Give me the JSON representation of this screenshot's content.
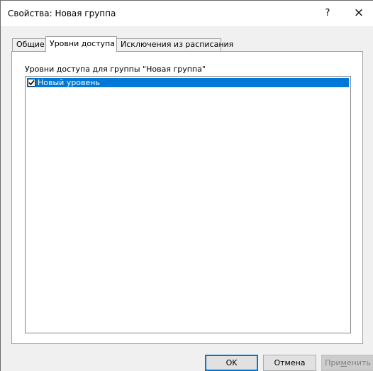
{
  "window": {
    "title": "Свойства: Новая группа",
    "help_glyph": "?",
    "close_glyph": "×"
  },
  "tabs": [
    {
      "label": "Общие",
      "active": false
    },
    {
      "label": "Уровни доступа",
      "active": true
    },
    {
      "label": "Исключения из расписания",
      "active": false
    }
  ],
  "access_page": {
    "group_label": "Уровни доступа для группы \"Новая группа\"",
    "items": [
      {
        "label": "Новый уровень",
        "checked": true,
        "selected": true
      }
    ]
  },
  "buttons": {
    "ok": "OK",
    "cancel": "Отмена",
    "apply_prefix": "При",
    "apply_mnemonic": "м",
    "apply_suffix": "енить"
  },
  "colors": {
    "selection": "#0078d7",
    "dialog_bg": "#f0f0f0",
    "default_button_border": "#0078d7",
    "disabled_text": "#838383"
  }
}
